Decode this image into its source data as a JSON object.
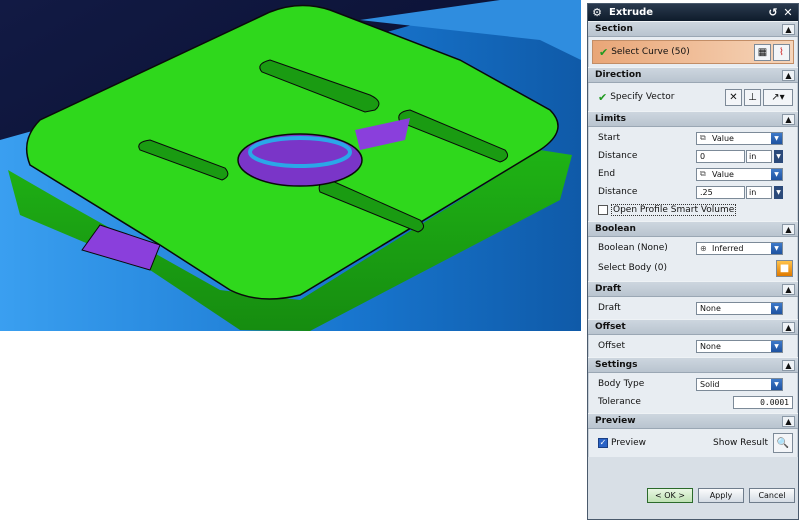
{
  "dialog": {
    "title": "Extrude",
    "title_icons": [
      "gear-icon",
      "reset-icon",
      "close-icon"
    ],
    "sections": {
      "section": {
        "label": "Section",
        "select_curve": "Select Curve (50)"
      },
      "direction": {
        "label": "Direction",
        "specify_vector": "Specify Vector"
      },
      "limits": {
        "label": "Limits",
        "start_label": "Start",
        "start_value": "Value",
        "start_distance_label": "Distance",
        "start_distance": "0",
        "start_unit": "in",
        "end_label": "End",
        "end_value": "Value",
        "end_distance_label": "Distance",
        "end_distance": ".25",
        "end_unit": "in",
        "open_profile": "Open Profile Smart Volume"
      },
      "boolean": {
        "label": "Boolean",
        "boolean_label": "Boolean (None)",
        "boolean_value": "Inferred",
        "select_body": "Select Body (0)"
      },
      "draft": {
        "label": "Draft",
        "draft_label": "Draft",
        "draft_value": "None"
      },
      "offset": {
        "label": "Offset",
        "offset_label": "Offset",
        "offset_value": "None"
      },
      "settings": {
        "label": "Settings",
        "body_type_label": "Body Type",
        "body_type_value": "Solid",
        "tolerance_label": "Tolerance",
        "tolerance_value": "0.0001"
      },
      "preview": {
        "label": "Preview",
        "preview_label": "Preview",
        "preview_checked": true,
        "show_result": "Show Result"
      }
    },
    "buttons": {
      "ok": "< OK >",
      "apply": "Apply",
      "cancel": "Cancel"
    }
  },
  "colors": {
    "background_dark": "#0b1540",
    "part_blue": "#1a78d0",
    "top_face_green": "#2ad41a",
    "pocket_purple": "#8a3fdc",
    "section_orange": "#e9a677"
  }
}
